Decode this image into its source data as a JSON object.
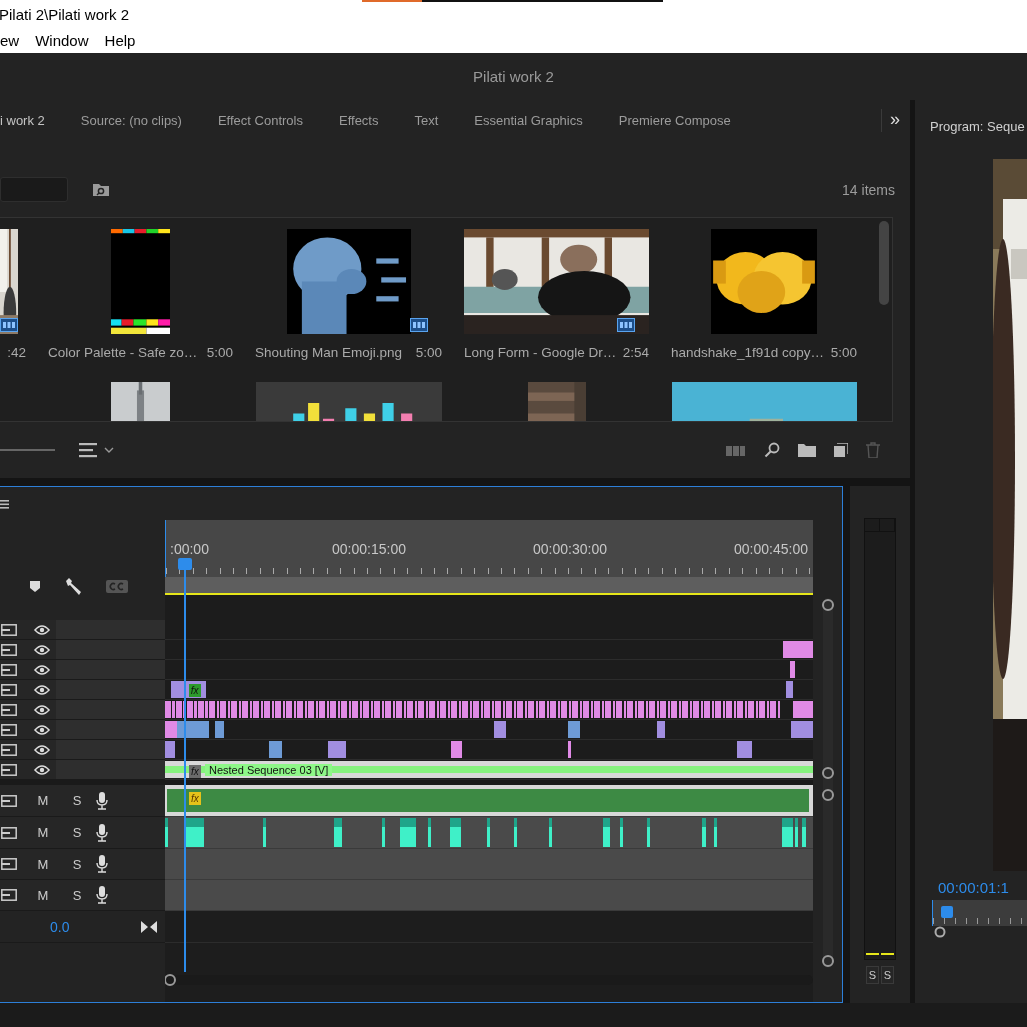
{
  "window": {
    "title": "Pilati 2\\Pilati work 2"
  },
  "menu": [
    {
      "label": "ew"
    },
    {
      "label": "Window"
    },
    {
      "label": "Help"
    }
  ],
  "app_title": "Pilati work 2",
  "tabs": [
    {
      "label": "i work 2",
      "selected": true
    },
    {
      "label": "Source: (no clips)",
      "selected": false
    },
    {
      "label": "Effect Controls",
      "selected": false
    },
    {
      "label": "Effects",
      "selected": false
    },
    {
      "label": "Text",
      "selected": false
    },
    {
      "label": "Essential Graphics",
      "selected": false
    },
    {
      "label": "Premiere Compose",
      "selected": false
    }
  ],
  "tabs_overflow": "»",
  "project": {
    "item_count": "14 items",
    "rows": [
      [
        {
          "duration": ":42"
        },
        {
          "name": "Color Palette - Safe zo…",
          "duration": "5:00"
        },
        {
          "name": "Shouting Man Emoji.png",
          "duration": "5:00"
        },
        {
          "name": "Long Form - Google Dr…",
          "duration": "2:54"
        },
        {
          "name": "handshake_1f91d copy…",
          "duration": "5:00"
        }
      ],
      [
        {
          "kind": "picture"
        },
        {
          "kind": "picture"
        },
        {
          "kind": "picture"
        },
        {
          "kind": "picture"
        }
      ]
    ]
  },
  "timeline": {
    "ruler": [
      ":00:00",
      "00:00:15:00",
      "00:00:30:00",
      "00:00:45:00"
    ],
    "tracks": [
      {
        "kind": "video"
      },
      {
        "kind": "video"
      },
      {
        "kind": "video"
      },
      {
        "kind": "video",
        "fx": "fx"
      },
      {
        "kind": "video"
      },
      {
        "kind": "video"
      },
      {
        "kind": "video"
      },
      {
        "kind": "video",
        "clip_label": "Nested Sequence 03 [V]",
        "fx": "fx"
      },
      {
        "kind": "audio",
        "mute": "M",
        "solo": "S",
        "fx": "fx"
      },
      {
        "kind": "audio",
        "mute": "M",
        "solo": "S"
      },
      {
        "kind": "audio",
        "mute": "M",
        "solo": "S"
      },
      {
        "kind": "audio",
        "mute": "M",
        "solo": "S"
      }
    ],
    "master_volume": "0.0"
  },
  "meter": {
    "solo_buttons": [
      "S",
      "S"
    ]
  },
  "program": {
    "title": "Program: Seque",
    "timecode": "00:00:01:1"
  }
}
